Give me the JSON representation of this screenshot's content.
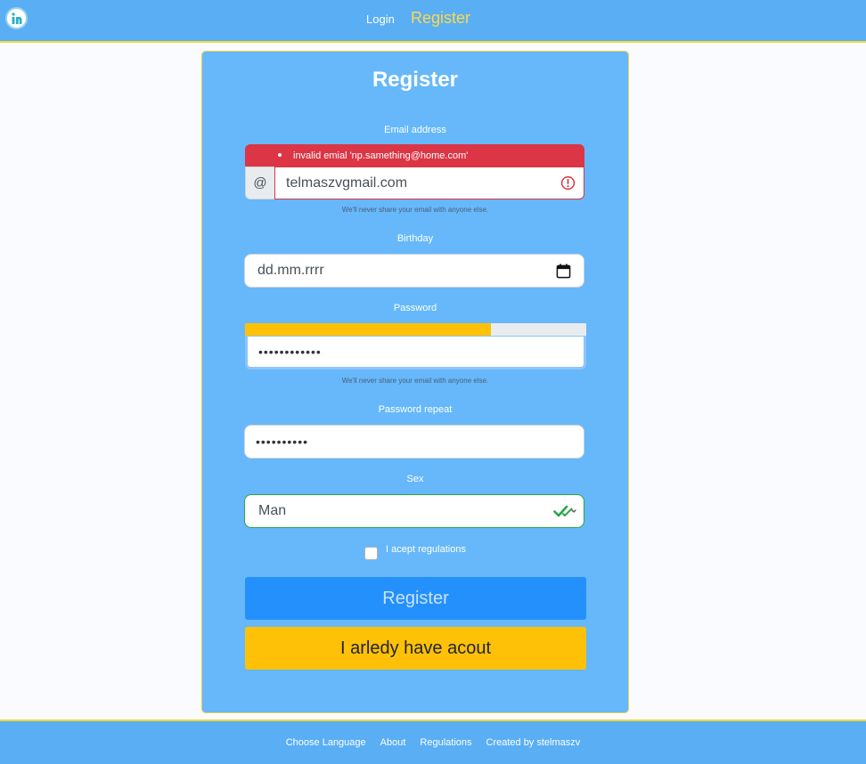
{
  "header": {
    "logo_letter": "n",
    "nav": {
      "login": "Login",
      "register": "Register"
    }
  },
  "form": {
    "title": "Register",
    "email": {
      "label": "Email address",
      "error": "invalid emial 'np.samething@home.com'",
      "addon": "@",
      "value": "telmaszvgmail.com",
      "help": "We'll never share your email with anyone else."
    },
    "birthday": {
      "label": "Birthday",
      "placeholder": "dd.mm.rrrr"
    },
    "password": {
      "label": "Password",
      "strength_percent": 72,
      "masked_value": "••••••••••••",
      "help": "We'll never share your email with anyone else."
    },
    "password_repeat": {
      "label": "Password repeat",
      "masked_value": "••••••••••"
    },
    "sex": {
      "label": "Sex",
      "selected": "Man"
    },
    "regulations": {
      "label": "I acept regulations",
      "checked": false
    },
    "register_button": "Register",
    "login_button": "I arledy have acout"
  },
  "footer": {
    "links": [
      "Choose Language",
      "About",
      "Regulations",
      "Created by stelmaszv"
    ]
  },
  "colors": {
    "header_bg": "#5aaef4",
    "card_bg": "#66b8fa",
    "accent_yellow": "#ffc107",
    "error_red": "#dc3545",
    "valid_green": "#28a745",
    "primary_blue": "#2490fb"
  },
  "icons": {
    "logo": "logo-icon",
    "error": "exclamation-circle-icon",
    "calendar": "calendar-icon",
    "valid": "double-check-icon"
  }
}
